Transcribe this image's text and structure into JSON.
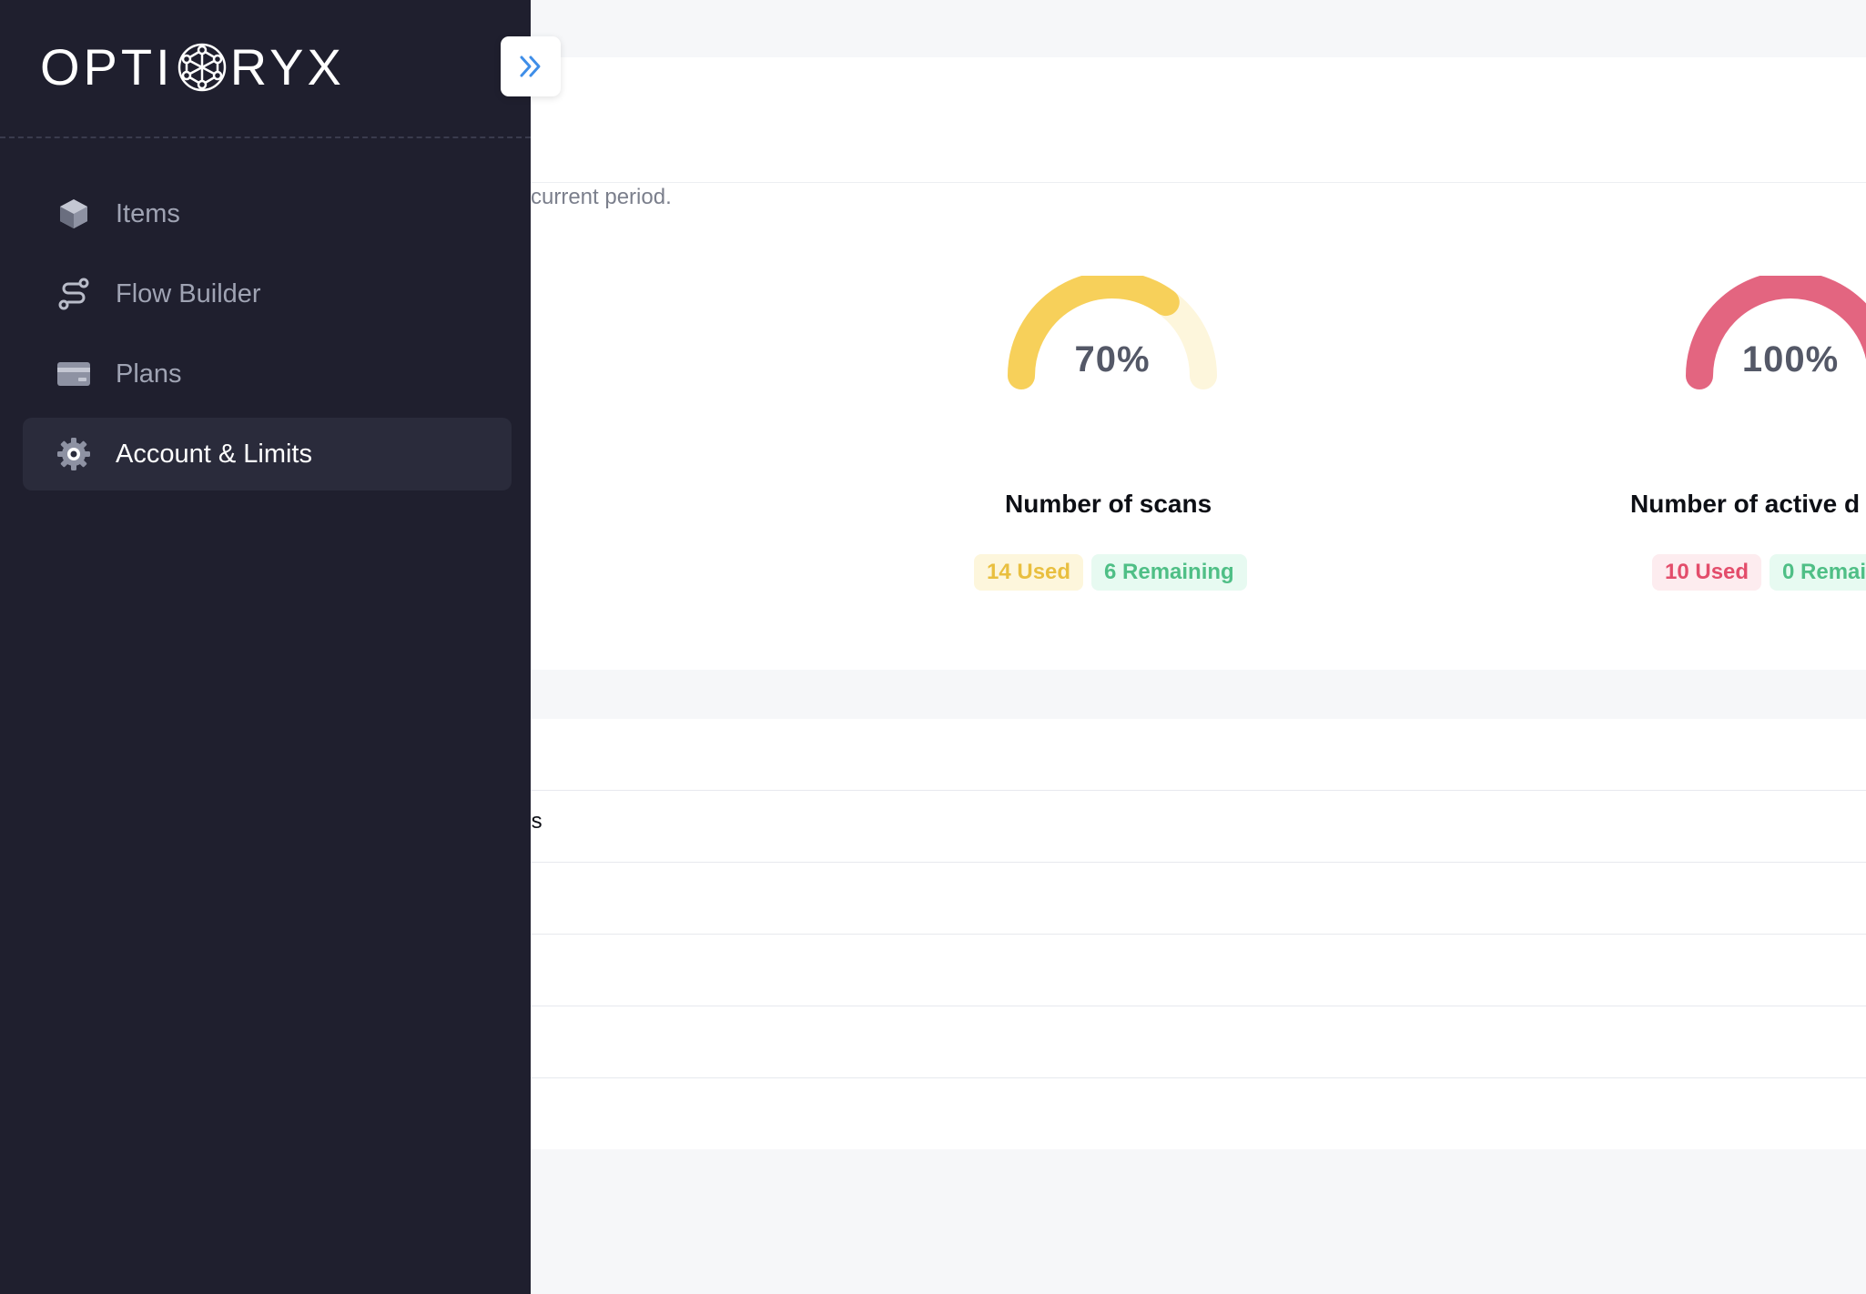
{
  "brand": {
    "name_left": "OPTI",
    "name_right": "RYX"
  },
  "sidebar": {
    "items": [
      {
        "label": "Items",
        "icon": "cube-icon",
        "active": false
      },
      {
        "label": "Flow Builder",
        "icon": "route-icon",
        "active": false
      },
      {
        "label": "Plans",
        "icon": "credit-card-icon",
        "active": false
      },
      {
        "label": "Account & Limits",
        "icon": "gear-icon",
        "active": true
      }
    ],
    "toggle_icon": "chevrons-right-icon"
  },
  "usage": {
    "subtitle": "current period.",
    "metrics": [
      {
        "title": "Number of scans",
        "percent_label": "70%",
        "percent": 70,
        "color": "#f7d05a",
        "track": "#fdf6dc",
        "used_label": "14 Used",
        "remaining_label": "6 Remaining"
      },
      {
        "title": "Number of active d",
        "percent_label": "100%",
        "percent": 100,
        "color": "#e36580",
        "track": "#fdecef",
        "used_label": "10 Used",
        "remaining_label": "0 Remai"
      }
    ]
  },
  "list": {
    "rows": [
      "",
      "ins",
      "",
      "",
      "",
      ""
    ]
  },
  "colors": {
    "sidebar_bg": "#1f1f2e",
    "accent_blue": "#3f8ee8",
    "yellow": "#f7d05a",
    "red": "#e36580",
    "green": "#4fbf86"
  }
}
